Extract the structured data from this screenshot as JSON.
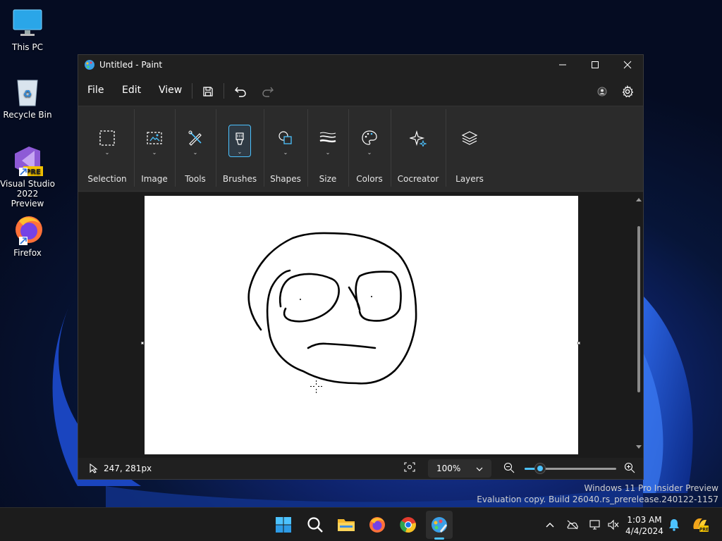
{
  "desktop": {
    "icons": [
      {
        "label": "This PC",
        "icon": "monitor-icon"
      },
      {
        "label": "Recycle Bin",
        "icon": "recycle-bin-icon"
      },
      {
        "label": "Visual Studio 2022 Preview",
        "icon": "visual-studio-icon",
        "badge": "PRE"
      },
      {
        "label": "Firefox",
        "icon": "firefox-icon"
      }
    ]
  },
  "window": {
    "title": "Untitled - Paint",
    "menu": {
      "file": "File",
      "edit": "Edit",
      "view": "View"
    },
    "ribbon": {
      "groups": [
        {
          "label": "Selection",
          "icon": "selection-icon"
        },
        {
          "label": "Image",
          "icon": "image-icon"
        },
        {
          "label": "Tools",
          "icon": "tools-icon"
        },
        {
          "label": "Brushes",
          "icon": "brush-icon",
          "selected": true
        },
        {
          "label": "Shapes",
          "icon": "shapes-icon"
        },
        {
          "label": "Size",
          "icon": "size-icon"
        },
        {
          "label": "Colors",
          "icon": "palette-icon"
        },
        {
          "label": "Cocreator",
          "icon": "sparkle-icon"
        },
        {
          "label": "Layers",
          "icon": "layers-icon"
        }
      ]
    },
    "status": {
      "coordinates": "247, 281px",
      "zoom": "100%",
      "zoom_slider_fraction": 0.17
    }
  },
  "watermark": {
    "line1": "Windows 11 Pro Insider Preview",
    "line2": "Evaluation copy. Build 26040.rs_prerelease.240122-1157"
  },
  "taskbar": {
    "apps": [
      "start-icon",
      "search-icon",
      "file-explorer-icon",
      "firefox-icon",
      "chrome-icon",
      "paint-icon"
    ],
    "time": "1:03 AM",
    "date": "4/4/2024"
  },
  "colors": {
    "accent": "#4cc2ff",
    "window_bg": "#202020",
    "ribbon_bg": "#2b2b2b",
    "canvas": "#ffffff"
  }
}
